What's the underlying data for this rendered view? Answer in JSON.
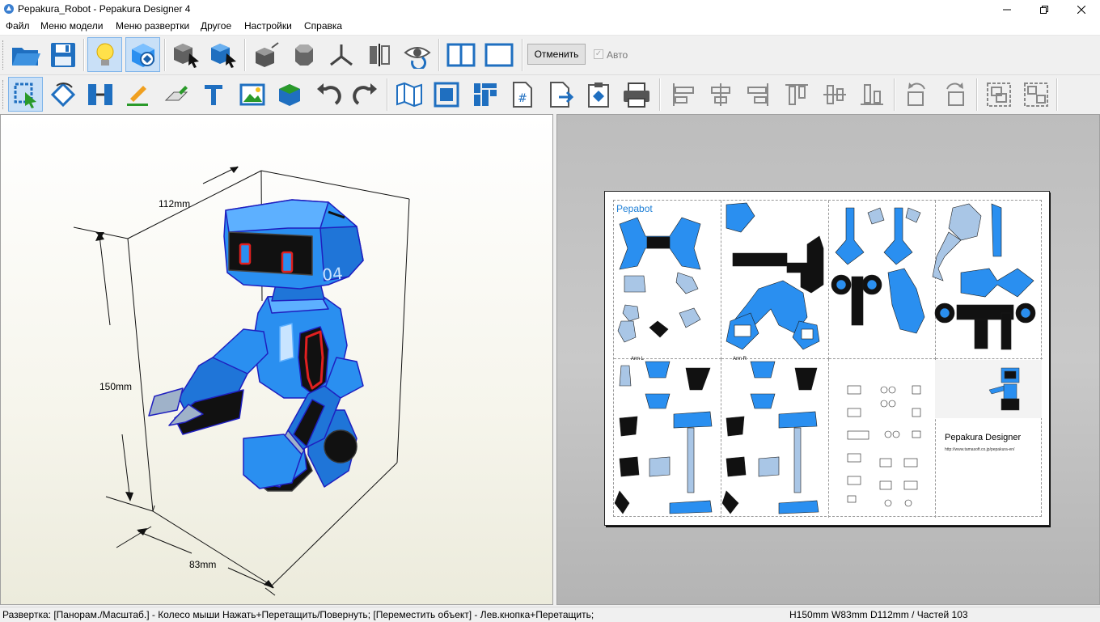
{
  "window": {
    "title": "Pepakura_Robot - Pepakura Designer 4"
  },
  "menu": [
    "Файл",
    "Меню модели",
    "Меню развертки",
    "Другое",
    "Настройки",
    "Справка"
  ],
  "toolbar": {
    "cancel_label": "Отменить",
    "auto_label": "Авто",
    "auto_checked": true
  },
  "view3d": {
    "dim_width": "112mm",
    "dim_height": "150mm",
    "dim_depth": "83mm"
  },
  "sheet": {
    "title": "Pepabot",
    "brand": "Pepakura Designer",
    "url": "http://www.tamasoft.co.jp/pepakura-en/",
    "arm_l": "Arm L",
    "arm_r": "Arm R"
  },
  "status": {
    "hint": "Развертка: [Панорам./Масштаб.] - Колесо мыши Нажать+Перетащить/Повернуть; [Переместить объект] - Лев.кнопка+Перетащить;",
    "info": "H150mm W83mm D112mm / Частей 103"
  },
  "colors": {
    "accent": "#1e7fd6",
    "robot_blue": "#2a8ff0",
    "robot_dark": "#0a0a0a",
    "robot_red": "#e02020"
  }
}
